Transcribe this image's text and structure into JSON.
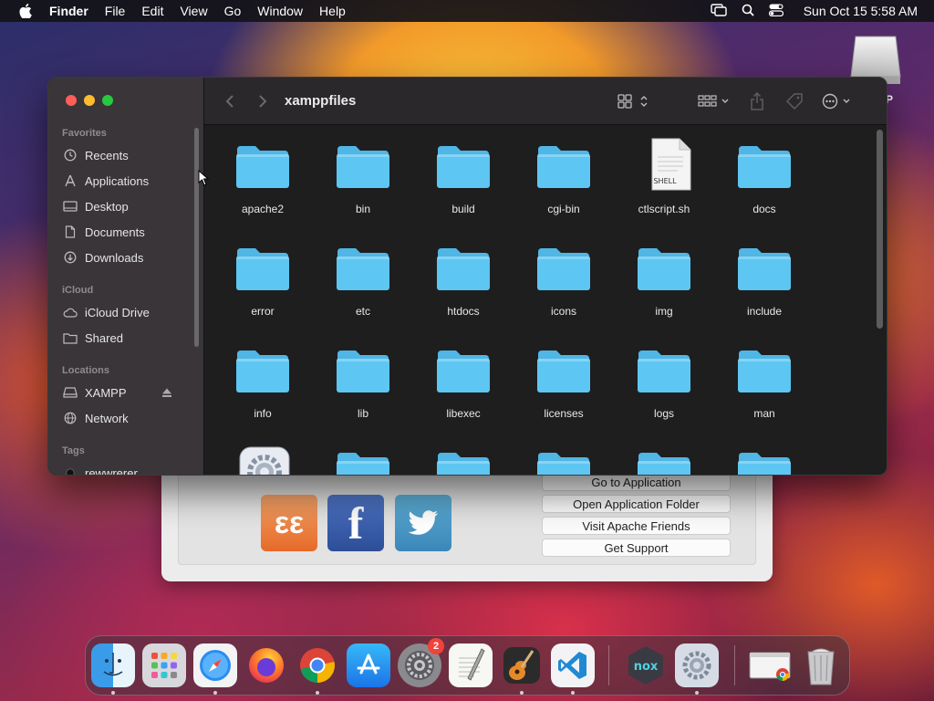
{
  "menubar": {
    "app_name": "Finder",
    "menus": [
      "File",
      "Edit",
      "View",
      "Go",
      "Window",
      "Help"
    ],
    "clock": "Sun Oct 15  5:58 AM"
  },
  "desktop": {
    "drive_label": "P"
  },
  "xampp": {
    "buttons": [
      "Go to Application",
      "Open Application Folder",
      "Visit Apache Friends",
      "Get Support"
    ],
    "icons": [
      "xampp-icon",
      "facebook-icon",
      "twitter-icon"
    ]
  },
  "finder": {
    "title": "xamppfiles",
    "sidebar": {
      "favorites_heading": "Favorites",
      "favorites": [
        "Recents",
        "Applications",
        "Desktop",
        "Documents",
        "Downloads"
      ],
      "icloud_heading": "iCloud",
      "icloud": [
        "iCloud Drive",
        "Shared"
      ],
      "locations_heading": "Locations",
      "locations": [
        "XAMPP",
        "Network"
      ],
      "tags_heading": "Tags",
      "tags": [
        "rewwrerer"
      ]
    },
    "files": [
      {
        "name": "apache2",
        "kind": "folder"
      },
      {
        "name": "bin",
        "kind": "folder"
      },
      {
        "name": "build",
        "kind": "folder"
      },
      {
        "name": "cgi-bin",
        "kind": "folder"
      },
      {
        "name": "ctlscript.sh",
        "kind": "shell"
      },
      {
        "name": "docs",
        "kind": "folder"
      },
      {
        "name": "error",
        "kind": "folder"
      },
      {
        "name": "etc",
        "kind": "folder"
      },
      {
        "name": "htdocs",
        "kind": "folder"
      },
      {
        "name": "icons",
        "kind": "folder"
      },
      {
        "name": "img",
        "kind": "folder"
      },
      {
        "name": "include",
        "kind": "folder"
      },
      {
        "name": "info",
        "kind": "folder"
      },
      {
        "name": "lib",
        "kind": "folder"
      },
      {
        "name": "libexec",
        "kind": "folder"
      },
      {
        "name": "licenses",
        "kind": "folder"
      },
      {
        "name": "logs",
        "kind": "folder"
      },
      {
        "name": "man",
        "kind": "folder"
      },
      {
        "name": "",
        "kind": "app"
      },
      {
        "name": "",
        "kind": "folder"
      },
      {
        "name": "",
        "kind": "folder"
      },
      {
        "name": "",
        "kind": "folder"
      },
      {
        "name": "",
        "kind": "folder"
      },
      {
        "name": "",
        "kind": "folder"
      }
    ],
    "shell_badge": "SHELL"
  },
  "dock": {
    "apps": [
      "finder-icon",
      "launchpad-icon",
      "safari-icon",
      "firefox-icon",
      "chrome-icon",
      "app-store-icon",
      "system-settings-icon",
      "textedit-icon",
      "garageband-icon",
      "vscode-icon",
      "nox-icon",
      "xampp-manager-icon",
      "chrome-window-icon",
      "trash-icon"
    ],
    "settings_badge": "2"
  },
  "colors": {
    "folder": "#5ec6f2",
    "folder_tab": "#4fb6e6",
    "accent_close": "#fe5f57",
    "accent_min": "#febc2e",
    "accent_max": "#28c840"
  }
}
